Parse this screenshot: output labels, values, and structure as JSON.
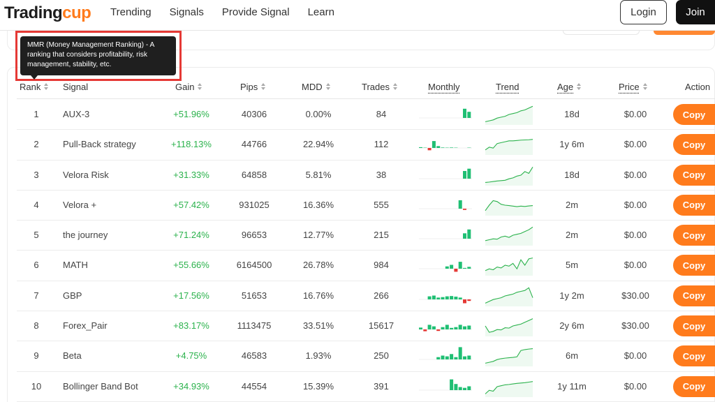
{
  "brand": {
    "part1": "Trading",
    "part2": "cup"
  },
  "nav": [
    "Trending",
    "Signals",
    "Provide Signal",
    "Learn"
  ],
  "auth": {
    "login": "Login",
    "join": "Join"
  },
  "tooltip": {
    "text": "MMR (Money Management Ranking) - A ranking that considers profitability, risk management, stability, etc."
  },
  "headers": {
    "rank": "Rank",
    "signal": "Signal",
    "gain": "Gain",
    "pips": "Pips",
    "mdd": "MDD",
    "trades": "Trades",
    "monthly": "Monthly",
    "trend": "Trend",
    "age": "Age",
    "price": "Price",
    "action": "Action"
  },
  "copy_label": "Copy",
  "colors": {
    "accent": "#ff7b1c",
    "gain": "#2bb24c",
    "bar_pos": "#1fbf73",
    "bar_neg": "#e53935",
    "trend": "#2bb24c"
  },
  "rows": [
    {
      "rank": "1",
      "signal": "AUX-3",
      "gain": "+51.96%",
      "pips": "40306",
      "mdd": "0.00%",
      "trades": "84",
      "age": "18d",
      "price": "$0.00",
      "monthly": [
        0,
        0,
        0,
        0,
        0,
        0,
        0,
        0,
        0,
        0,
        0.6,
        0.4
      ],
      "trend": [
        0.1,
        0.15,
        0.2,
        0.3,
        0.35,
        0.4,
        0.5,
        0.55,
        0.6,
        0.7,
        0.75,
        0.85,
        0.95
      ]
    },
    {
      "rank": "2",
      "signal": "Pull-Back strategy",
      "gain": "+118.13%",
      "pips": "44766",
      "mdd": "22.94%",
      "trades": "112",
      "age": "1y 6m",
      "price": "$0.00",
      "monthly": [
        0.05,
        0.02,
        -0.15,
        0.45,
        0.12,
        0.03,
        0.02,
        0.03,
        0.02,
        0,
        0,
        0.02
      ],
      "trend": [
        0.2,
        0.35,
        0.3,
        0.55,
        0.6,
        0.65,
        0.7,
        0.7,
        0.72,
        0.74,
        0.75,
        0.76,
        0.78
      ]
    },
    {
      "rank": "3",
      "signal": "Velora Risk",
      "gain": "+31.33%",
      "pips": "64858",
      "mdd": "5.81%",
      "trades": "38",
      "age": "18d",
      "price": "$0.00",
      "monthly": [
        0,
        0,
        0,
        0,
        0,
        0,
        0,
        0,
        0,
        0,
        0.5,
        0.65
      ],
      "trend": [
        0.1,
        0.12,
        0.15,
        0.18,
        0.2,
        0.22,
        0.3,
        0.35,
        0.45,
        0.5,
        0.7,
        0.6,
        0.95
      ]
    },
    {
      "rank": "4",
      "signal": "Velora +",
      "gain": "+57.42%",
      "pips": "931025",
      "mdd": "16.36%",
      "trades": "555",
      "age": "2m",
      "price": "$0.00",
      "monthly": [
        0,
        0,
        0,
        0,
        0,
        0,
        0,
        0,
        0,
        0.55,
        -0.08,
        0
      ],
      "trend": [
        0.2,
        0.5,
        0.75,
        0.7,
        0.55,
        0.5,
        0.48,
        0.45,
        0.42,
        0.45,
        0.43,
        0.46,
        0.48
      ]
    },
    {
      "rank": "5",
      "signal": "the journey",
      "gain": "+71.24%",
      "pips": "96653",
      "mdd": "12.77%",
      "trades": "215",
      "age": "2m",
      "price": "$0.00",
      "monthly": [
        0,
        0,
        0,
        0,
        0,
        0,
        0,
        0,
        0,
        0,
        0.35,
        0.6
      ],
      "trend": [
        0.2,
        0.25,
        0.3,
        0.28,
        0.4,
        0.45,
        0.38,
        0.5,
        0.55,
        0.6,
        0.7,
        0.8,
        0.95
      ]
    },
    {
      "rank": "6",
      "signal": "MATH",
      "gain": "+55.66%",
      "pips": "6164500",
      "mdd": "26.78%",
      "trades": "984",
      "age": "5m",
      "price": "$0.00",
      "monthly": [
        0,
        0,
        0,
        0,
        0,
        0,
        0.15,
        0.25,
        -0.2,
        0.45,
        0.05,
        0.12
      ],
      "trend": [
        0.2,
        0.3,
        0.25,
        0.4,
        0.35,
        0.5,
        0.45,
        0.6,
        0.3,
        0.8,
        0.5,
        0.85,
        0.9
      ]
    },
    {
      "rank": "7",
      "signal": "GBP",
      "gain": "+17.56%",
      "pips": "51653",
      "mdd": "16.76%",
      "trades": "266",
      "age": "1y 2m",
      "price": "$30.00",
      "monthly": [
        0,
        0,
        0.2,
        0.25,
        0.12,
        0.15,
        0.2,
        0.22,
        0.18,
        0.12,
        -0.25,
        -0.1
      ],
      "trend": [
        0.1,
        0.2,
        0.3,
        0.35,
        0.4,
        0.5,
        0.55,
        0.6,
        0.7,
        0.75,
        0.8,
        0.95,
        0.4
      ]
    },
    {
      "rank": "8",
      "signal": "Forex_Pair",
      "gain": "+83.17%",
      "pips": "1113475",
      "mdd": "33.51%",
      "trades": "15617",
      "age": "2y 6m",
      "price": "$30.00",
      "monthly": [
        0.12,
        -0.12,
        0.3,
        0.2,
        -0.1,
        0.15,
        0.3,
        0.1,
        0.15,
        0.3,
        0.2,
        0.25
      ],
      "trend": [
        0.5,
        0.15,
        0.2,
        0.3,
        0.28,
        0.4,
        0.38,
        0.5,
        0.55,
        0.6,
        0.7,
        0.8,
        0.9
      ]
    },
    {
      "rank": "9",
      "signal": "Beta",
      "gain": "+4.75%",
      "pips": "46583",
      "mdd": "1.93%",
      "trades": "250",
      "age": "6m",
      "price": "$0.00",
      "monthly": [
        0,
        0,
        0,
        0,
        0.15,
        0.25,
        0.2,
        0.35,
        0.15,
        0.8,
        0.2,
        0.25
      ],
      "trend": [
        0.1,
        0.15,
        0.2,
        0.3,
        0.35,
        0.38,
        0.4,
        0.42,
        0.45,
        0.8,
        0.85,
        0.88,
        0.9
      ]
    },
    {
      "rank": "10",
      "signal": "Bollinger Band Bot",
      "gain": "+34.93%",
      "pips": "44554",
      "mdd": "15.39%",
      "trades": "391",
      "age": "1y 11m",
      "price": "$0.00",
      "monthly": [
        0,
        0,
        0,
        0,
        0,
        0,
        0,
        0.7,
        0.4,
        0.2,
        0.15,
        0.25
      ],
      "trend": [
        0.1,
        0.3,
        0.25,
        0.5,
        0.55,
        0.6,
        0.62,
        0.65,
        0.68,
        0.7,
        0.72,
        0.75,
        0.78
      ]
    }
  ]
}
